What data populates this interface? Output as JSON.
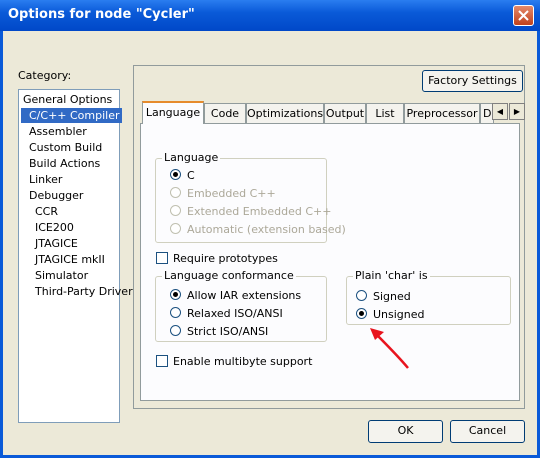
{
  "window": {
    "title": "Options for node \"Cycler\""
  },
  "category": {
    "label": "Category:",
    "items": [
      {
        "label": "General Options"
      },
      {
        "label": "C/C++ Compiler"
      },
      {
        "label": "Assembler"
      },
      {
        "label": "Custom Build"
      },
      {
        "label": "Build Actions"
      },
      {
        "label": "Linker"
      },
      {
        "label": "Debugger"
      },
      {
        "label": "CCR"
      },
      {
        "label": "ICE200"
      },
      {
        "label": "JTAGICE"
      },
      {
        "label": "JTAGICE mkII"
      },
      {
        "label": "Simulator"
      },
      {
        "label": "Third-Party Driver"
      }
    ]
  },
  "factory_settings_label": "Factory Settings",
  "tabs": [
    {
      "label": "Language"
    },
    {
      "label": "Code"
    },
    {
      "label": "Optimizations"
    },
    {
      "label": "Output"
    },
    {
      "label": "List"
    },
    {
      "label": "Preprocessor"
    },
    {
      "label": "D"
    }
  ],
  "language_group": {
    "title": "Language",
    "options": [
      {
        "label": "C",
        "checked": true,
        "enabled": true
      },
      {
        "label": "Embedded C++",
        "checked": false,
        "enabled": false
      },
      {
        "label": "Extended Embedded C++",
        "checked": false,
        "enabled": false
      },
      {
        "label": "Automatic (extension based)",
        "checked": false,
        "enabled": false
      }
    ]
  },
  "require_prototypes": {
    "label": "Require prototypes",
    "checked": false
  },
  "conformance_group": {
    "title": "Language conformance",
    "options": [
      {
        "label": "Allow IAR extensions",
        "checked": true
      },
      {
        "label": "Relaxed ISO/ANSI",
        "checked": false
      },
      {
        "label": "Strict ISO/ANSI",
        "checked": false
      }
    ]
  },
  "char_group": {
    "title": "Plain 'char' is",
    "options": [
      {
        "label": "Signed",
        "checked": false
      },
      {
        "label": "Unsigned",
        "checked": true
      }
    ]
  },
  "multibyte": {
    "label": "Enable multibyte support",
    "checked": false
  },
  "ok_label": "OK",
  "cancel_label": "Cancel",
  "colors": {
    "titlebar": "#0a5ad8",
    "selection": "#316ac5",
    "annotation_arrow": "#e8141e"
  }
}
